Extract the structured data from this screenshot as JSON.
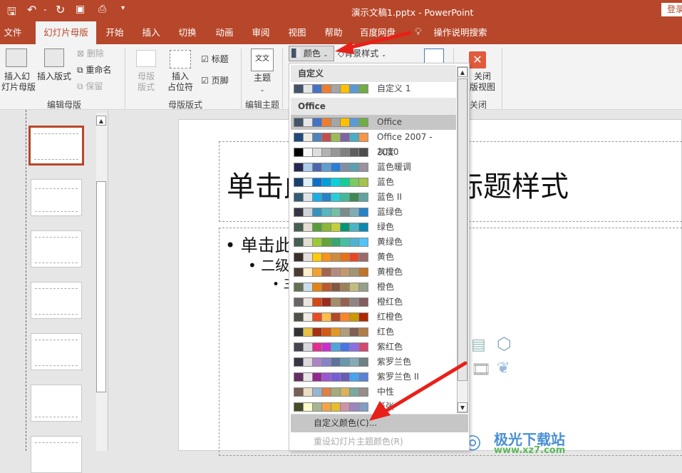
{
  "titlebar": {
    "doc_title": "演示文稿1.pptx  -  PowerPoint",
    "login": "登录"
  },
  "tabs": [
    {
      "label": "文件"
    },
    {
      "label": "幻灯片母版",
      "active": true
    },
    {
      "label": "开始"
    },
    {
      "label": "插入"
    },
    {
      "label": "切换"
    },
    {
      "label": "动画"
    },
    {
      "label": "审阅"
    },
    {
      "label": "视图"
    },
    {
      "label": "帮助"
    },
    {
      "label": "百度网盘"
    },
    {
      "label": "操作说明搜索"
    }
  ],
  "ribbon": {
    "insert_master": "插入幻\n灯片母版",
    "insert_layout": "插入版式",
    "delete": "删除",
    "rename": "重命名",
    "preserve": "保留",
    "group1": "编辑母版",
    "master_layout": "母版\n版式",
    "insert_placeholder": "插入\n占位符",
    "title_cb": "标题",
    "footer_cb": "页脚",
    "group2": "母版版式",
    "theme": "主题",
    "group3": "编辑主题",
    "colors": "颜色",
    "background_styles": "背景样式",
    "close_view": "关闭\n版视图",
    "group_close": "关闭"
  },
  "menu": {
    "custom_header": "自定义",
    "office_header": "Office",
    "custom": [
      {
        "name": "自定义 1",
        "colors": [
          "#44546a",
          "#e7e6e6",
          "#4472c4",
          "#ed7d31",
          "#a5a5a5",
          "#ffc000",
          "#5b9bd5",
          "#70ad47"
        ]
      }
    ],
    "themes": [
      {
        "name": "Office",
        "selected": true,
        "colors": [
          "#44546a",
          "#e7e6e6",
          "#4472c4",
          "#ed7d31",
          "#a5a5a5",
          "#ffc000",
          "#5b9bd5",
          "#70ad47"
        ]
      },
      {
        "name": "Office 2007 - 2010",
        "colors": [
          "#1f497d",
          "#eeece1",
          "#4f81bd",
          "#c0504d",
          "#9bbb59",
          "#8064a2",
          "#4bacc6",
          "#f79646"
        ]
      },
      {
        "name": "灰度",
        "colors": [
          "#000000",
          "#f8f8f8",
          "#dddddd",
          "#b2b2b2",
          "#969696",
          "#808080",
          "#5f5f5f",
          "#4d4d4d"
        ]
      },
      {
        "name": "蓝色暖调",
        "colors": [
          "#242852",
          "#acccea",
          "#4a66ac",
          "#629dd1",
          "#297fd5",
          "#7f8fa9",
          "#5aa2ae",
          "#9d90a0"
        ]
      },
      {
        "name": "蓝色",
        "colors": [
          "#17406d",
          "#dbeff9",
          "#0f6fc6",
          "#009dd9",
          "#0bd0d9",
          "#10cf9b",
          "#7cca62",
          "#a5c249"
        ]
      },
      {
        "name": "蓝色 II",
        "colors": [
          "#335b74",
          "#dfe3e5",
          "#1cade4",
          "#2683c6",
          "#27ced7",
          "#42ba97",
          "#3e8853",
          "#62a39f"
        ]
      },
      {
        "name": "蓝绿色",
        "colors": [
          "#373545",
          "#ced3dc",
          "#3494ba",
          "#58b6c0",
          "#75bda7",
          "#7a8c8e",
          "#84acb6",
          "#2683c6"
        ]
      },
      {
        "name": "绿色",
        "colors": [
          "#455f51",
          "#e3ded1",
          "#549e39",
          "#8ab833",
          "#c0cf3a",
          "#029676",
          "#4ab5c4",
          "#0989b1"
        ]
      },
      {
        "name": "黄绿色",
        "colors": [
          "#455f51",
          "#e3ded1",
          "#99cb38",
          "#63a537",
          "#37a76f",
          "#44c1a3",
          "#4eb3cf",
          "#51c3f9"
        ]
      },
      {
        "name": "黄色",
        "colors": [
          "#39302a",
          "#e5dedb",
          "#ffca08",
          "#f8931d",
          "#ce8d3e",
          "#ec7016",
          "#e64823",
          "#9c6a6a"
        ]
      },
      {
        "name": "黄橙色",
        "colors": [
          "#4e3b30",
          "#fbeec9",
          "#f0a22e",
          "#a5644e",
          "#b58b80",
          "#c3986d",
          "#a19574",
          "#c17529"
        ]
      },
      {
        "name": "橙色",
        "colors": [
          "#637052",
          "#ccddea",
          "#e48312",
          "#bd582c",
          "#865640",
          "#9b8357",
          "#c2bc80",
          "#94a088"
        ]
      },
      {
        "name": "橙红色",
        "colors": [
          "#696464",
          "#e9e5dc",
          "#d34817",
          "#9b2d1f",
          "#a28e6a",
          "#956251",
          "#918485",
          "#855d5d"
        ]
      },
      {
        "name": "红橙色",
        "colors": [
          "#505046",
          "#eeece1",
          "#e84c22",
          "#ffbd47",
          "#b64926",
          "#ff8427",
          "#cc9900",
          "#b22600"
        ]
      },
      {
        "name": "红色",
        "colors": [
          "#323232",
          "#e5c243",
          "#a5300f",
          "#d55816",
          "#e19825",
          "#b19c7d",
          "#7f5f52",
          "#b27d49"
        ]
      },
      {
        "name": "紫红色",
        "colors": [
          "#454551",
          "#d8d9dc",
          "#e32d91",
          "#c830cc",
          "#4ea6dc",
          "#4775e7",
          "#8971e1",
          "#d54773"
        ]
      },
      {
        "name": "紫罗兰色",
        "colors": [
          "#373545",
          "#dcd8dc",
          "#ad84c6",
          "#8784c7",
          "#5d739a",
          "#6997af",
          "#84acb6",
          "#6f8183"
        ]
      },
      {
        "name": "紫罗兰色 II",
        "colors": [
          "#632e62",
          "#eae5eb",
          "#92278f",
          "#9b57d3",
          "#755dd9",
          "#665eb8",
          "#45a5ed",
          "#5982db"
        ]
      },
      {
        "name": "中性",
        "colors": [
          "#775f55",
          "#ebddc3",
          "#94b6d2",
          "#dd8047",
          "#a5ab81",
          "#d8b25c",
          "#7ba79d",
          "#968c8c"
        ]
      },
      {
        "name": "纸张",
        "colors": [
          "#444d26",
          "#fefac9",
          "#a5b592",
          "#f3a447",
          "#e7bc29",
          "#d092a7",
          "#9c85c0",
          "#809ec2"
        ]
      }
    ],
    "customize_colors": "自定义颜色(C)...",
    "reset_colors": "重设幻灯片主题颜色(R)"
  },
  "slide": {
    "title": "单击此处编辑母版标题样式",
    "body1": "单击此处编辑母版文本样式",
    "body2": "二级",
    "body3": "三级"
  },
  "watermark": {
    "name": "极光下载站",
    "url": "www.xz7.com"
  },
  "colors": {
    "accent": "#b7472a",
    "annotation_arrow": "#e8201a"
  }
}
